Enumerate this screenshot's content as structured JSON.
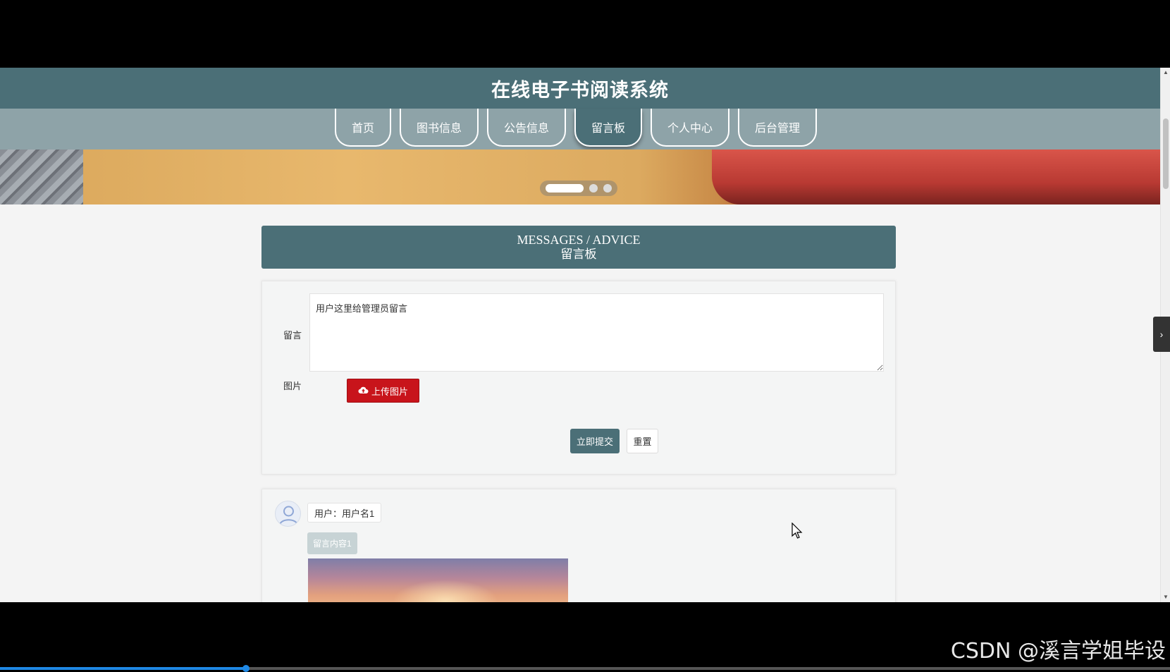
{
  "header": {
    "title": "在线电子书阅读系统"
  },
  "nav": {
    "items": [
      {
        "label": "首页"
      },
      {
        "label": "图书信息"
      },
      {
        "label": "公告信息"
      },
      {
        "label": "留言板",
        "active": true
      },
      {
        "label": "个人中心"
      },
      {
        "label": "后台管理"
      }
    ]
  },
  "banner": {
    "slide_count": 3,
    "active_slide": 0
  },
  "section": {
    "title_en": "MESSAGES / ADVICE",
    "title_cn": "留言板"
  },
  "form": {
    "message_label": "留言",
    "message_value": "用户这里给管理员留言",
    "image_label": "图片",
    "upload_label": "上传图片",
    "submit_label": "立即提交",
    "reset_label": "重置"
  },
  "messages": [
    {
      "user": "用户：用户名1",
      "content": "留言内容1"
    }
  ],
  "watermark": "CSDN @溪言学姐毕设",
  "video_progress": 0.21,
  "colors": {
    "primary": "#4b6f77",
    "nav_bg": "#8ea3a8",
    "upload": "#c8141b"
  }
}
